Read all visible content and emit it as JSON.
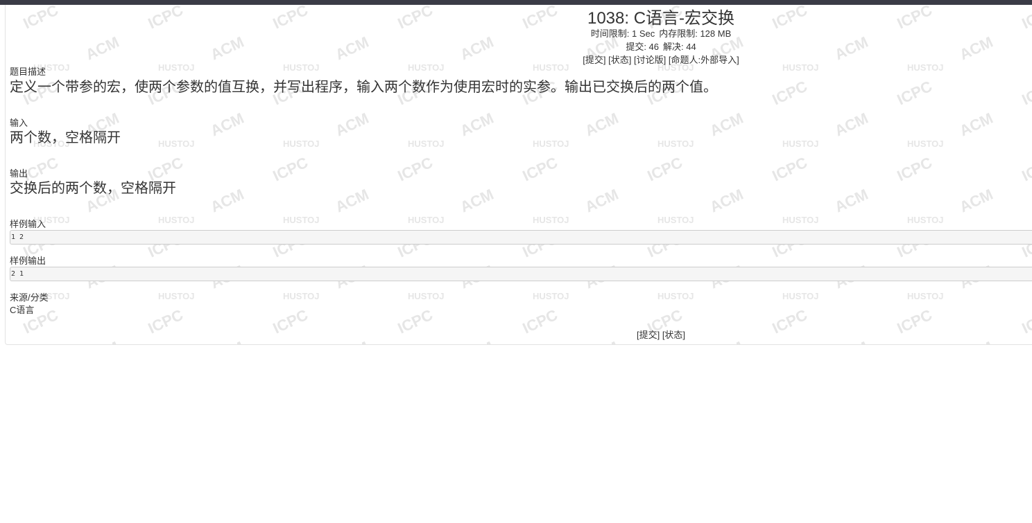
{
  "problem": {
    "title": "1038: C语言-宏交换",
    "time_limit": "时间限制: 1 Sec",
    "memory_limit": "内存限制: 128 MB",
    "submitted": "提交: 46",
    "solved": "解决: 44",
    "links": {
      "submit": "[提交]",
      "status": "[状态]",
      "discuss": "[讨论版]",
      "author": "[命题人:外部导入]"
    }
  },
  "sections": {
    "description_label": "题目描述",
    "description": "定义一个带参的宏，使两个参数的值互换，并写出程序，输入两个数作为使用宏时的实参。输出已交换后的两个值。",
    "input_label": "输入",
    "input": "两个数，空格隔开",
    "output_label": "输出",
    "output": "交换后的两个数，空格隔开",
    "sample_input_label": "样例输入",
    "sample_input": "1 2",
    "sample_output_label": "样例输出",
    "sample_output": "2 1",
    "source_label": "来源/分类",
    "source": "C语言"
  },
  "footer": {
    "submit": "[提交]",
    "status": "[状态]"
  },
  "watermark": {
    "texts": [
      "ICPC",
      "ACM",
      "HUSTOJ"
    ],
    "color": "#e6e6e6"
  },
  "colors": {
    "topbar": "#3a3b46",
    "text": "#333333",
    "code_bg": "#f5f5f5",
    "code_border": "#cccccc"
  }
}
